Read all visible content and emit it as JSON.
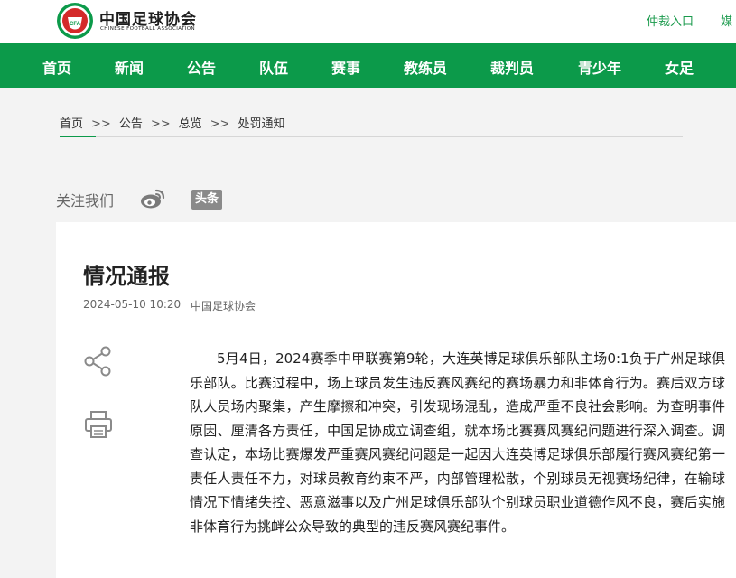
{
  "header": {
    "logo_title": "中国足球协会",
    "logo_subtitle": "CHINESE FOOTBALL ASSOCIATION",
    "logo_badge": "CFA",
    "top_links": [
      "仲裁入口",
      "媒"
    ]
  },
  "nav": {
    "items": [
      "首页",
      "新闻",
      "公告",
      "队伍",
      "赛事",
      "教练员",
      "裁判员",
      "青少年",
      "女足"
    ]
  },
  "breadcrumb": {
    "items": [
      "首页",
      "公告",
      "总览",
      "处罚通知"
    ],
    "separator": ">>"
  },
  "follow": {
    "label": "关注我们",
    "icons": [
      "weibo-icon",
      "toutiao-icon"
    ],
    "toutiao_label": "头条"
  },
  "article": {
    "title": "情况通报",
    "date": "2024-05-10 10:20",
    "source": "中国足球协会",
    "body": "5月4日，2024赛季中甲联赛第9轮，大连英博足球俱乐部队主场0:1负于广州足球俱乐部队。比赛过程中，场上球员发生违反赛风赛纪的赛场暴力和非体育行为。赛后双方球队人员场内聚集，产生摩擦和冲突，引发现场混乱，造成严重不良社会影响。为查明事件原因、厘清各方责任，中国足协成立调查组，就本场比赛赛风赛纪问题进行深入调查。调查认定，本场比赛爆发严重赛风赛纪问题是一起因大连英博足球俱乐部履行赛风赛纪第一责任人责任不力，对球员教育约束不严，内部管理松散，个别球员无视赛场纪律，在输球情况下情绪失控、恶意滋事以及广州足球俱乐部队个别球员职业道德作风不良，赛后实施非体育行为挑衅公众导致的典型的违反赛风赛纪事件。"
  },
  "tools": {
    "icons": [
      "share-icon",
      "print-icon"
    ]
  },
  "colors": {
    "brand_green": "#0c9a4a",
    "link_green": "#1a9a4c",
    "logo_red": "#d42a2a"
  }
}
